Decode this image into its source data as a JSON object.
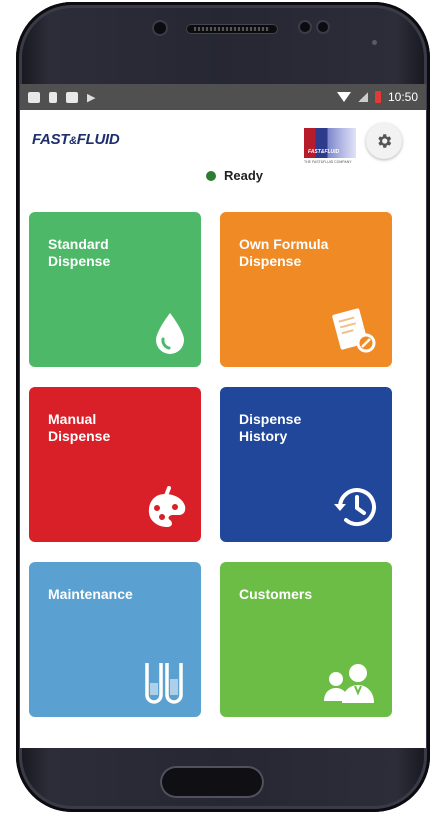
{
  "status_bar": {
    "time": "10:50"
  },
  "header": {
    "brand_main": "FAST",
    "brand_amp": "&",
    "brand_tail": "FLUID",
    "logo_text": "FAST&FLUID",
    "logo_sub": "THE FAST&FLUID COMPANY",
    "settings_icon": "gear-icon"
  },
  "status": {
    "text": "Ready",
    "color": "#2e7d32"
  },
  "tiles": [
    {
      "label": "Standard\nDispense",
      "color": "#4db868",
      "icon": "drop-icon"
    },
    {
      "label": "Own Formula\nDispense",
      "color": "#f08a24",
      "icon": "formula-document-icon"
    },
    {
      "label": "Manual\nDispense",
      "color": "#d92028",
      "icon": "paint-palette-icon"
    },
    {
      "label": "Dispense\nHistory",
      "color": "#21479b",
      "icon": "history-clock-icon"
    },
    {
      "label": "Maintenance",
      "color": "#5aa0d0",
      "icon": "test-tubes-icon"
    },
    {
      "label": "Customers",
      "color": "#6cbd45",
      "icon": "customers-icon"
    }
  ]
}
